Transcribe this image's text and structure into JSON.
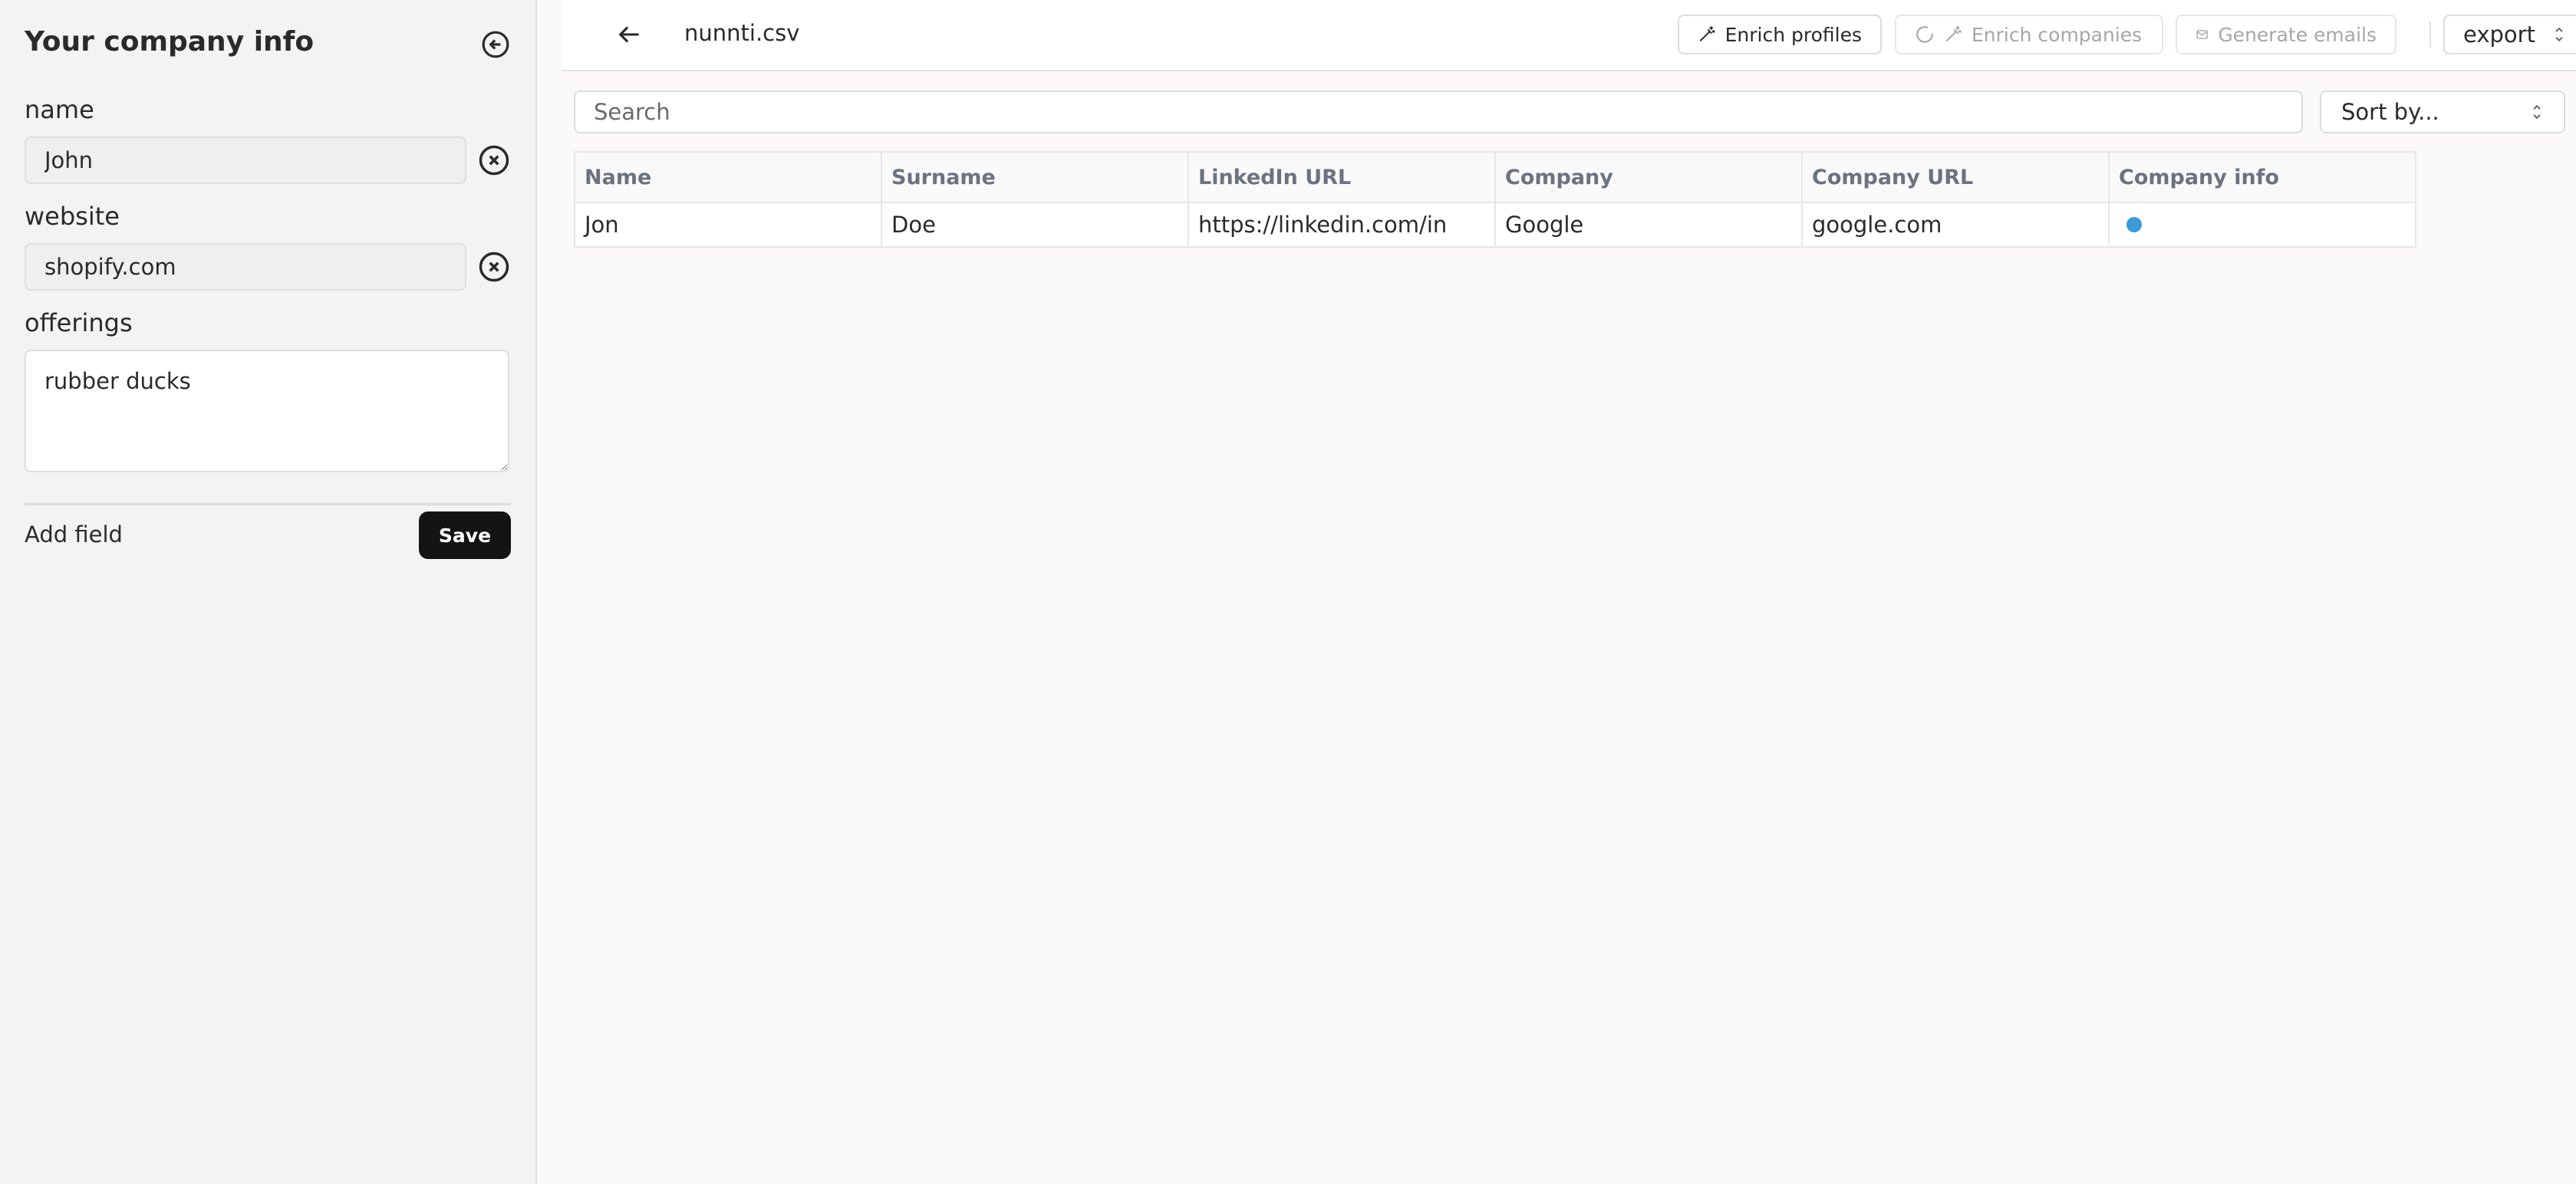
{
  "sidebar": {
    "title": "Your company info",
    "fields": [
      {
        "label": "name",
        "value": "John"
      },
      {
        "label": "website",
        "value": "shopify.com"
      }
    ],
    "offerings": {
      "label": "offerings",
      "value": "rubber ducks"
    },
    "add_field": "Add field",
    "save": "Save"
  },
  "header": {
    "file_name": "nunnti.csv",
    "buttons": {
      "enrich_profiles": "Enrich profiles",
      "enrich_companies": "Enrich companies",
      "generate_emails": "Generate emails",
      "export": "export"
    }
  },
  "search": {
    "placeholder": "Search"
  },
  "sort": {
    "label": "Sort by..."
  },
  "table": {
    "columns": [
      "Name",
      "Surname",
      "LinkedIn URL",
      "Company",
      "Company URL",
      "Company info"
    ],
    "rows": [
      [
        "Jon",
        "Doe",
        "https://linkedin.com/in",
        "Google",
        "google.com",
        ""
      ]
    ]
  },
  "colors": {
    "status_dot": "#3b9bd9",
    "save_button": "#141414"
  },
  "icons": [
    "collapse-panel-icon",
    "remove-circle-icon",
    "back-arrow-icon",
    "magic-wand-icon",
    "spinner-icon",
    "mail-icon",
    "chevron-updown-icon"
  ]
}
